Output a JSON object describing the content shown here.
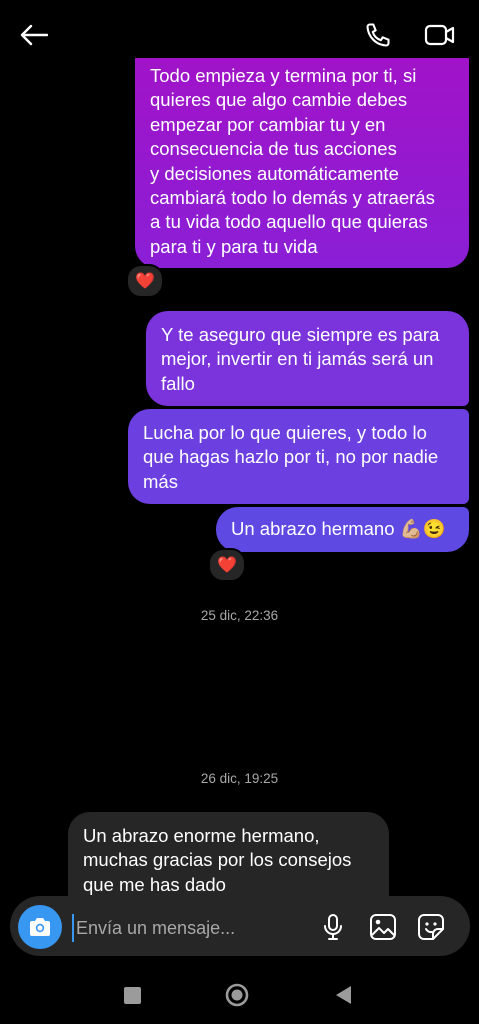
{
  "header": {},
  "messages": [
    {
      "id": "sent1",
      "text": "Todo empieza y termina por ti, si\nquieres que algo cambie debes\nempezar por cambiar tu y en\nconsecuencia de tus acciones\ny decisiones automáticamente\ncambiará todo lo demás y atraerás\na tu vida todo aquello que quieras\npara ti y para tu vida"
    },
    {
      "id": "sent2",
      "text": "Y te aseguro que siempre es para\nmejor, invertir en ti jamás será un\nfallo"
    },
    {
      "id": "sent3",
      "text": "Lucha por lo que quieres, y todo lo\nque hagas hazlo por ti, no por nadie\nmás"
    },
    {
      "id": "sent4",
      "text": "Un abrazo hermano 💪🏼😉"
    },
    {
      "id": "recv1",
      "text": "Un abrazo enorme hermano,\nmuchas gracias por los consejos\nque me has dado"
    }
  ],
  "reactions": {
    "r1": "❤️",
    "r2": "❤️"
  },
  "timestamps": {
    "t1": "25 dic, 22:36",
    "t2": "26 dic, 19:25"
  },
  "composer": {
    "placeholder": "Envía un mensaje..."
  },
  "colors": {
    "accent": "#3897f0",
    "bubble_top": "#a113c8",
    "bubble_bottom": "#5e49e2",
    "received": "#262626"
  }
}
